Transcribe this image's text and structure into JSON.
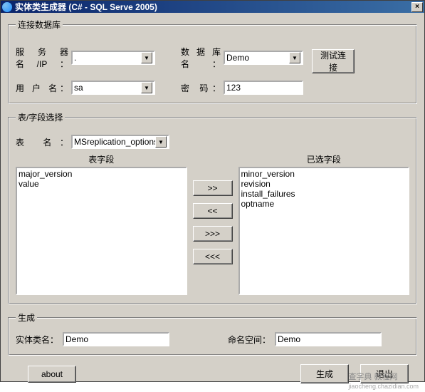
{
  "title": "实体类生成器 (C# - SQL Serve 2005)",
  "close_label": "×",
  "group_conn": {
    "legend": "连接数据库",
    "server_label": "服务器名/IP",
    "server_value": ".",
    "db_label": "数据库名",
    "db_value": "Demo",
    "user_label": "用 户 名",
    "user_value": "sa",
    "pwd_label": "密    码",
    "pwd_value": "123",
    "test_btn": "测试连接"
  },
  "group_table": {
    "legend": "表/字段选择",
    "table_label": "表    名",
    "table_value": "MSreplication_options",
    "left_header": "表字段",
    "right_header": "已选字段",
    "left_items": [
      "major_version",
      "value"
    ],
    "right_items": [
      "minor_version",
      "revision",
      "install_failures",
      "optname"
    ],
    "btn_add": ">>",
    "btn_remove": "<<",
    "btn_addall": ">>>",
    "btn_removeall": "<<<"
  },
  "group_gen": {
    "legend": "生成",
    "class_label": "实体类名：",
    "class_value": "Demo",
    "ns_label": "命名空间：",
    "ns_value": "Demo"
  },
  "buttons": {
    "about": "about",
    "generate": "生成",
    "exit": "退出"
  },
  "watermark": {
    "main": "查字典 教程网",
    "sub": "jiaocheng.chazidian.com"
  }
}
